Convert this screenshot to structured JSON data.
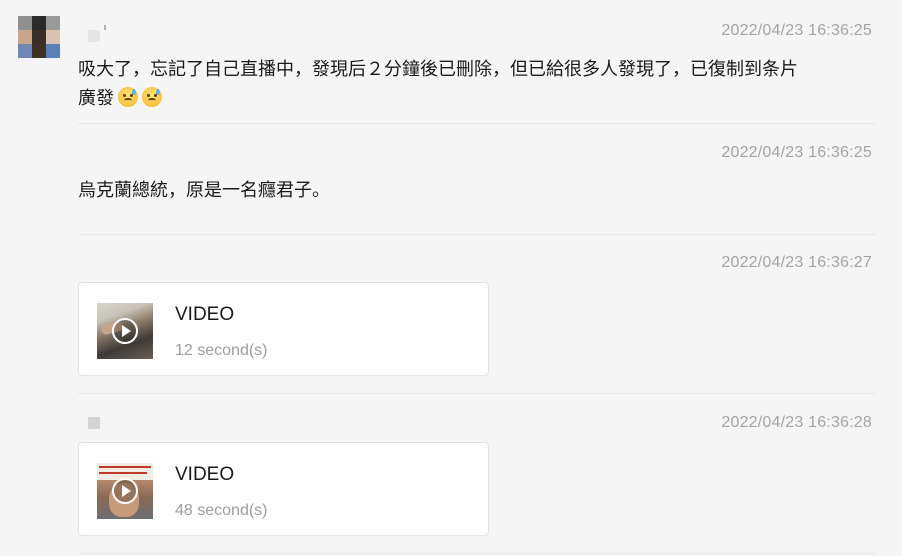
{
  "colors": {
    "background": "#f5f5f5",
    "timestamp": "#a3a3a3",
    "text": "#1a1a1a",
    "card_border": "#e2e2e2"
  },
  "messages": [
    {
      "timestamp": "2022/04/23 16:36:25",
      "text": "吸大了，忘記了自己直播中，發現后２分鐘後已刪除，但已給很多人發現了，已復制到条片",
      "text_line2": "廣發",
      "emojis": [
        "sad-sweat-emoji",
        "sad-sweat-emoji"
      ]
    },
    {
      "timestamp": "2022/04/23 16:36:25",
      "text": "烏克蘭總統，原是一名癮君子。"
    },
    {
      "timestamp": "2022/04/23 16:36:27",
      "video": {
        "label": "VIDEO",
        "duration": "12 second(s)",
        "thumbnail_icon": "play-icon"
      }
    },
    {
      "timestamp": "2022/04/23 16:36:28",
      "video": {
        "label": "VIDEO",
        "duration": "48 second(s)",
        "thumbnail_icon": "play-icon"
      }
    }
  ]
}
